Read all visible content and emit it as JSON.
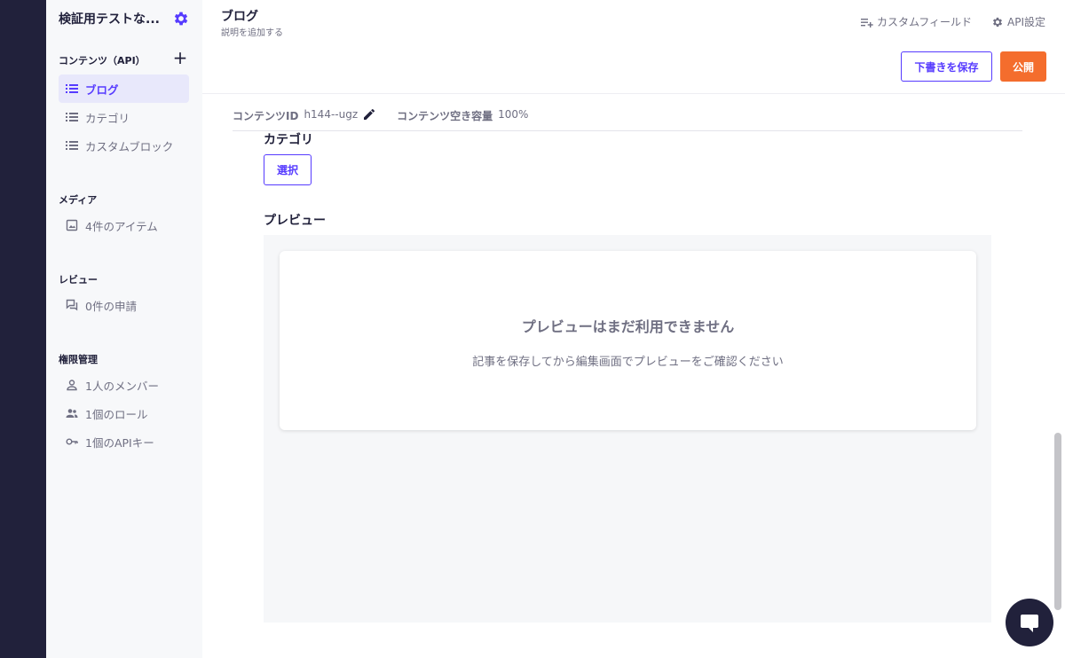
{
  "sidebar": {
    "service_name": "検証用テストな...",
    "sections": {
      "contents": "コンテンツ（API）",
      "media": "メディア",
      "review": "レビュー",
      "permissions": "権限管理"
    },
    "add_icon": "plus-icon",
    "items": {
      "blog": "ブログ",
      "category": "カテゴリ",
      "custom_block": "カスタムブロック",
      "media_items": "4件のアイテム",
      "requests": "0件の申請",
      "members": "1人のメンバー",
      "roles": "1個のロール",
      "api_keys": "1個のAPIキー"
    }
  },
  "header": {
    "title": "ブログ",
    "subtitle": "説明を追加する",
    "custom_field": "カスタムフィールド",
    "api_settings": "API設定",
    "save_draft": "下書きを保存",
    "publish": "公開"
  },
  "meta": {
    "content_id_label": "コンテンツID",
    "content_id_value": "h144--ugz",
    "capacity_label": "コンテンツ空き容量",
    "capacity_value": "100%"
  },
  "form": {
    "category_label": "カテゴリ",
    "select_button": "選択",
    "preview_label": "プレビュー"
  },
  "preview": {
    "title": "プレビューはまだ利用できません",
    "description": "記事を保存してから編集画面でプレビューをご確認ください"
  },
  "colors": {
    "accent": "#563bff",
    "publish": "#f46d2d",
    "rail": "#21213b"
  }
}
